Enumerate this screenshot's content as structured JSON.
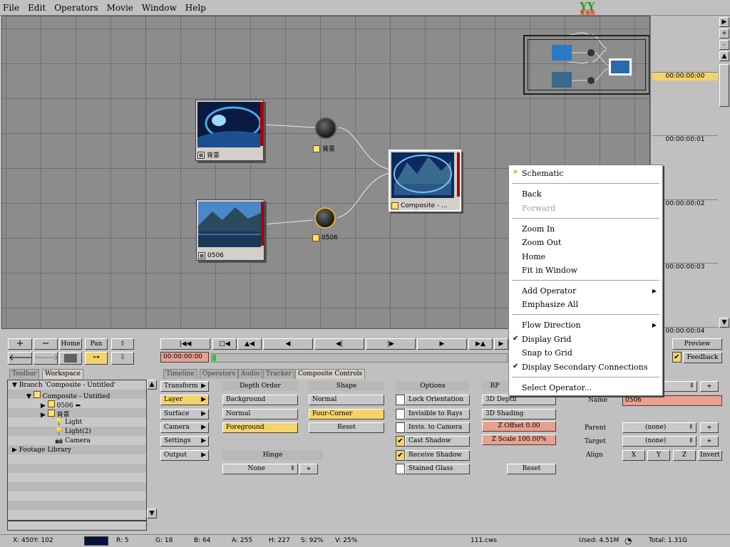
{
  "menu": [
    "File",
    "Edit",
    "Operators",
    "Movie",
    "Window",
    "Help"
  ],
  "logo": {
    "text": "YY",
    "sub": "育语苑"
  },
  "nodes": {
    "bg": {
      "label": "背景",
      "ball_label": "背景"
    },
    "n0506": {
      "label": "0506",
      "ball_label": "0506"
    },
    "composite": {
      "label": "Composite - ..."
    }
  },
  "timeline": {
    "codes": [
      "00:00:00:00",
      "00:00:00:01",
      "00:00:00:02",
      "00:00:00:03",
      "00:00:00:04"
    ],
    "scroll": [
      "+",
      "-",
      "▲",
      "▼",
      "▶"
    ]
  },
  "context_menu": {
    "schematic": "Schematic",
    "back": "Back",
    "forward": "Forward",
    "zoom_in": "Zoom In",
    "zoom_out": "Zoom Out",
    "home": "Home",
    "fit": "Fit in Window",
    "add_operator": "Add Operator",
    "emphasize": "Emphasize All",
    "flow": "Flow Direction",
    "display_grid": "Display Grid",
    "snap_grid": "Snap to Grid",
    "display_secondary": "Display Secondary Connections",
    "select_operator": "Select Operator..."
  },
  "toolbar": {
    "plus": "+",
    "minus": "−",
    "home": "Home",
    "pan": "Pan",
    "time": "00:00:00:00",
    "preview": "Preview",
    "feedback": "Feedback"
  },
  "tabs_left": [
    "Toolbar",
    "Workspace"
  ],
  "tabs_right": [
    "Timeline",
    "Operators",
    "Audio",
    "Tracker",
    "Composite Controls"
  ],
  "tree": {
    "branch": "Branch 'Composite - Untitled'",
    "composite": "Composite - Untitled",
    "item0506": "0506",
    "item_bg": "背景",
    "light": "Light",
    "light2": "Light(2)",
    "camera": "Camera",
    "footage": "Footage Library"
  },
  "categories": [
    "Transform",
    "Layer",
    "Surface",
    "Camera",
    "Settings",
    "Output"
  ],
  "depth_order": {
    "header": "Depth Order",
    "items": [
      "Background",
      "Normal",
      "Foreground"
    ]
  },
  "shape": {
    "header": "Shape",
    "items": [
      "Normal",
      "Four-Corner",
      "Reset"
    ]
  },
  "hinge": {
    "header": "Hinge",
    "value": "None"
  },
  "options": {
    "header": "Options",
    "items": [
      "Lock Orientation",
      "Invisible to Rays",
      "Invis. to Camera",
      "Cast Shadow",
      "Receive Shadow",
      "Stained Glass"
    ]
  },
  "rp": {
    "header": "RP",
    "depth": "3D Depth",
    "shading": "3D Shading",
    "z_offset": "Z Offset 0.00",
    "z_scale": "Z Scale 100.00%",
    "reset": "Reset"
  },
  "props": {
    "name_label": "Name",
    "name_value": "0506",
    "parent_label": "Parent",
    "parent_value": "(none)",
    "target_label": "Target",
    "target_value": "(none)",
    "align_label": "Align",
    "x": "X",
    "y": "Y",
    "z": "Z",
    "invert": "Invert"
  },
  "status": {
    "x": "X:  450Y:  102",
    "r": "R: 5",
    "g": "G: 18",
    "b": "B: 64",
    "a": "A: 255",
    "h": "H: 227",
    "s": "S: 92%",
    "v": "V: 25%",
    "file": "111.cws",
    "used": "Used: 4.51M",
    "total": "Total: 1.31G"
  }
}
